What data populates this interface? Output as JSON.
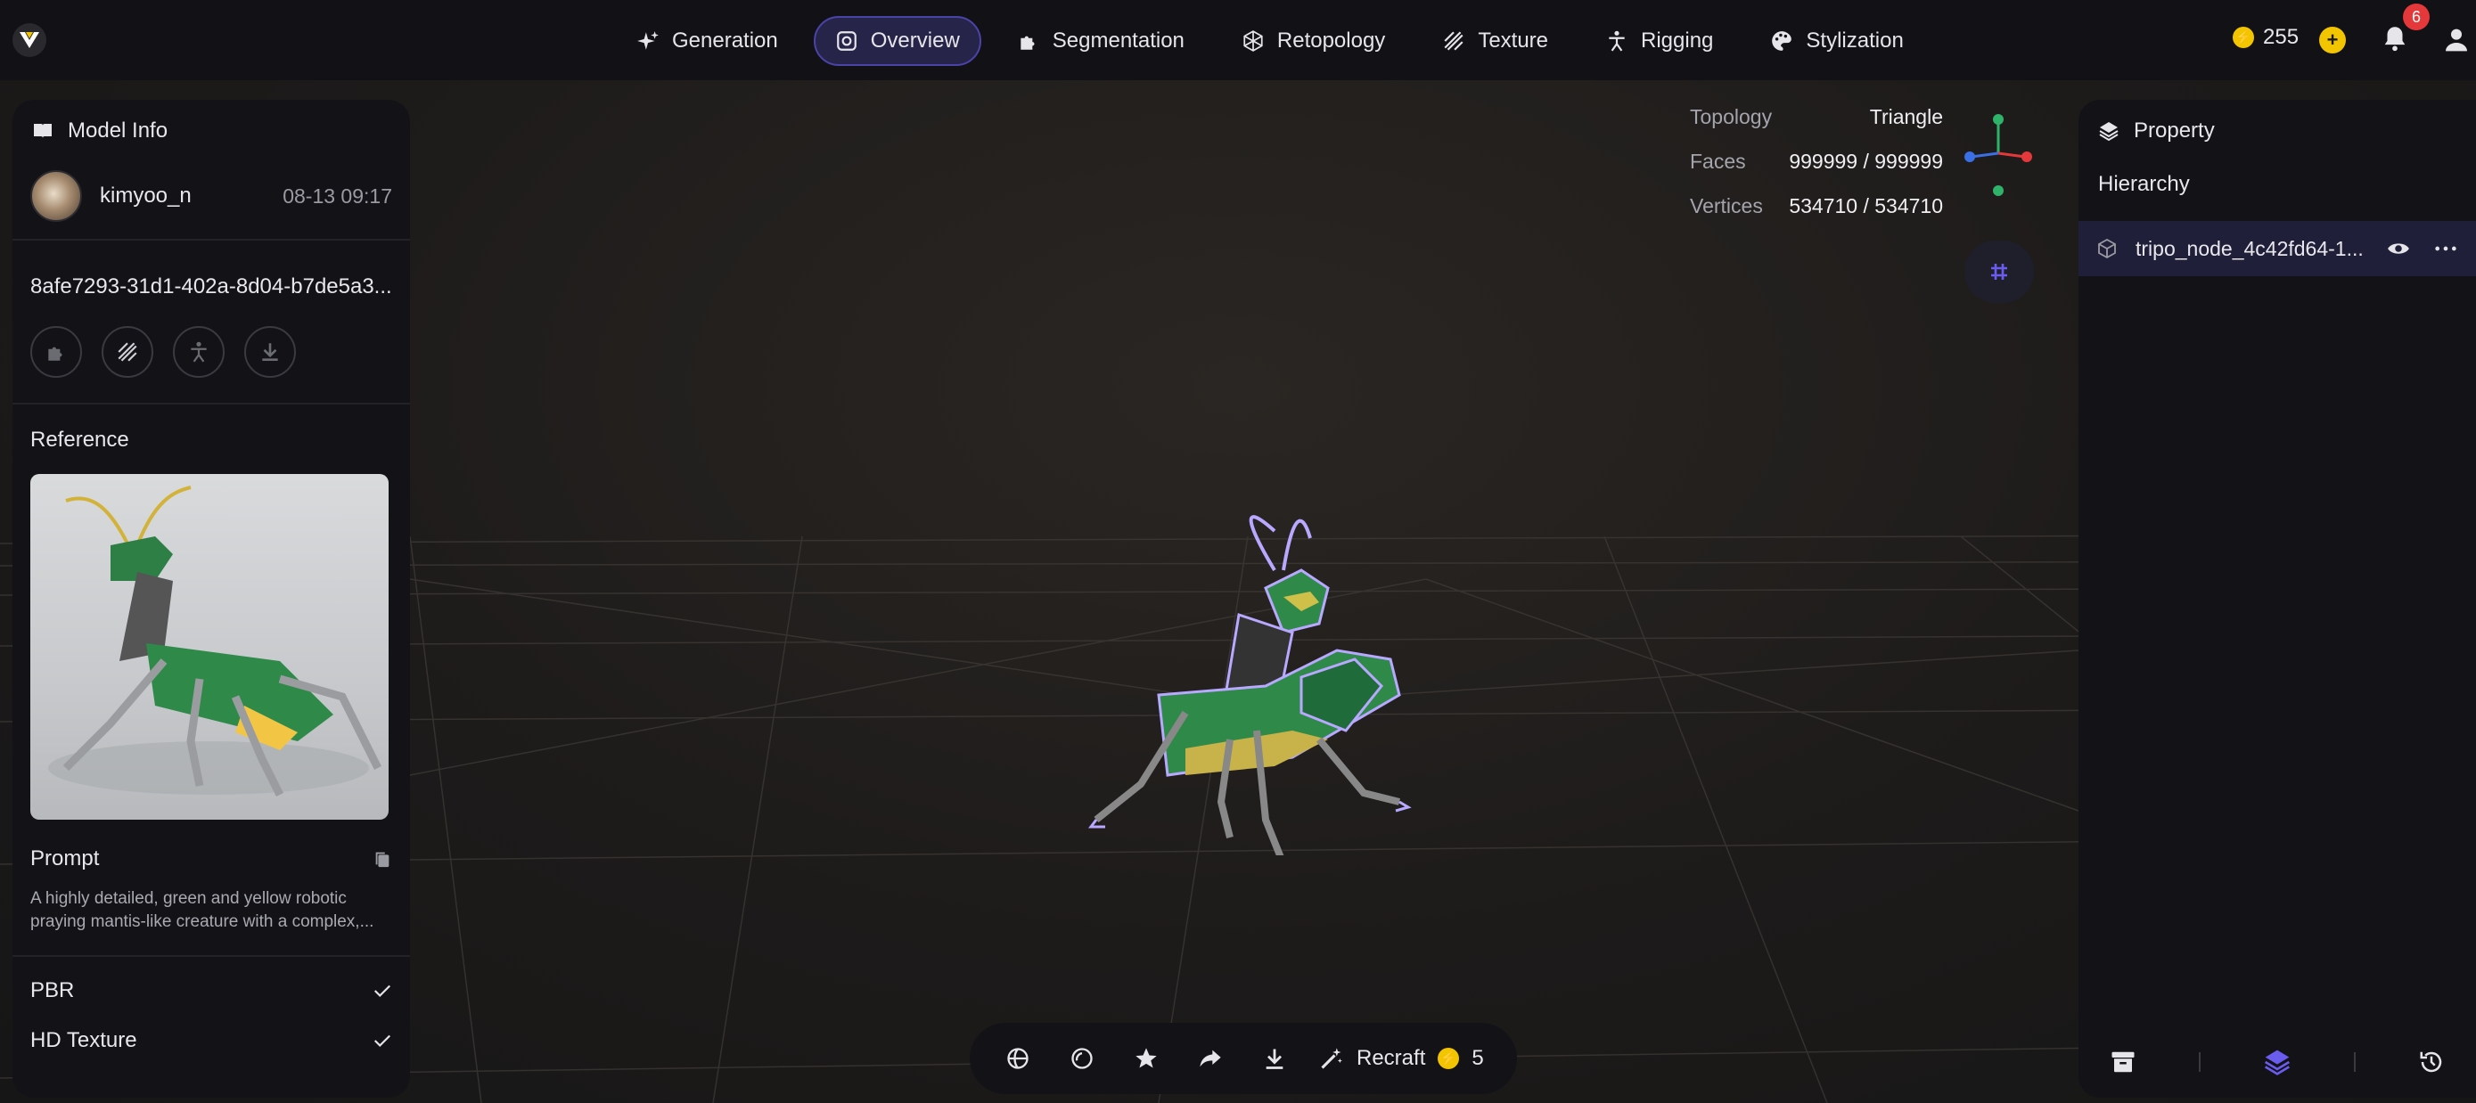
{
  "nav": {
    "items": [
      {
        "label": "Generation",
        "icon": "sparkle-icon"
      },
      {
        "label": "Overview",
        "icon": "overview-icon",
        "active": true
      },
      {
        "label": "Segmentation",
        "icon": "puzzle-icon"
      },
      {
        "label": "Retopology",
        "icon": "mesh-icon"
      },
      {
        "label": "Texture",
        "icon": "texture-icon"
      },
      {
        "label": "Rigging",
        "icon": "person-icon"
      },
      {
        "label": "Stylization",
        "icon": "palette-icon"
      }
    ],
    "credits": "255",
    "notification_count": "6"
  },
  "model_info": {
    "title": "Model Info",
    "username": "kimyoo_n",
    "date": "08-13 09:17",
    "task_id": "8afe7293-31d1-402a-8d04-b7de5a3...",
    "reference_title": "Reference",
    "prompt_title": "Prompt",
    "prompt_text": "A highly detailed, green and yellow robotic praying mantis-like creature with a complex,...",
    "options": [
      {
        "label": "PBR",
        "checked": true
      },
      {
        "label": "HD Texture",
        "checked": true
      }
    ]
  },
  "stats": {
    "topology_label": "Topology",
    "topology_value": "Triangle",
    "faces_label": "Faces",
    "faces_value": "999999 / 999999",
    "vertices_label": "Vertices",
    "vertices_value": "534710 / 534710"
  },
  "property": {
    "title": "Property",
    "hierarchy_label": "Hierarchy",
    "node_name": "tripo_node_4c42fd64-1..."
  },
  "toolbar": {
    "recraft_label": "Recraft",
    "recraft_cost": "5"
  },
  "colors": {
    "accent": "#5b4fe0",
    "coin": "#f2c500",
    "badge": "#e5383b",
    "mantis_green": "#2f8a4a",
    "selection_outline": "#b9a8ff"
  }
}
